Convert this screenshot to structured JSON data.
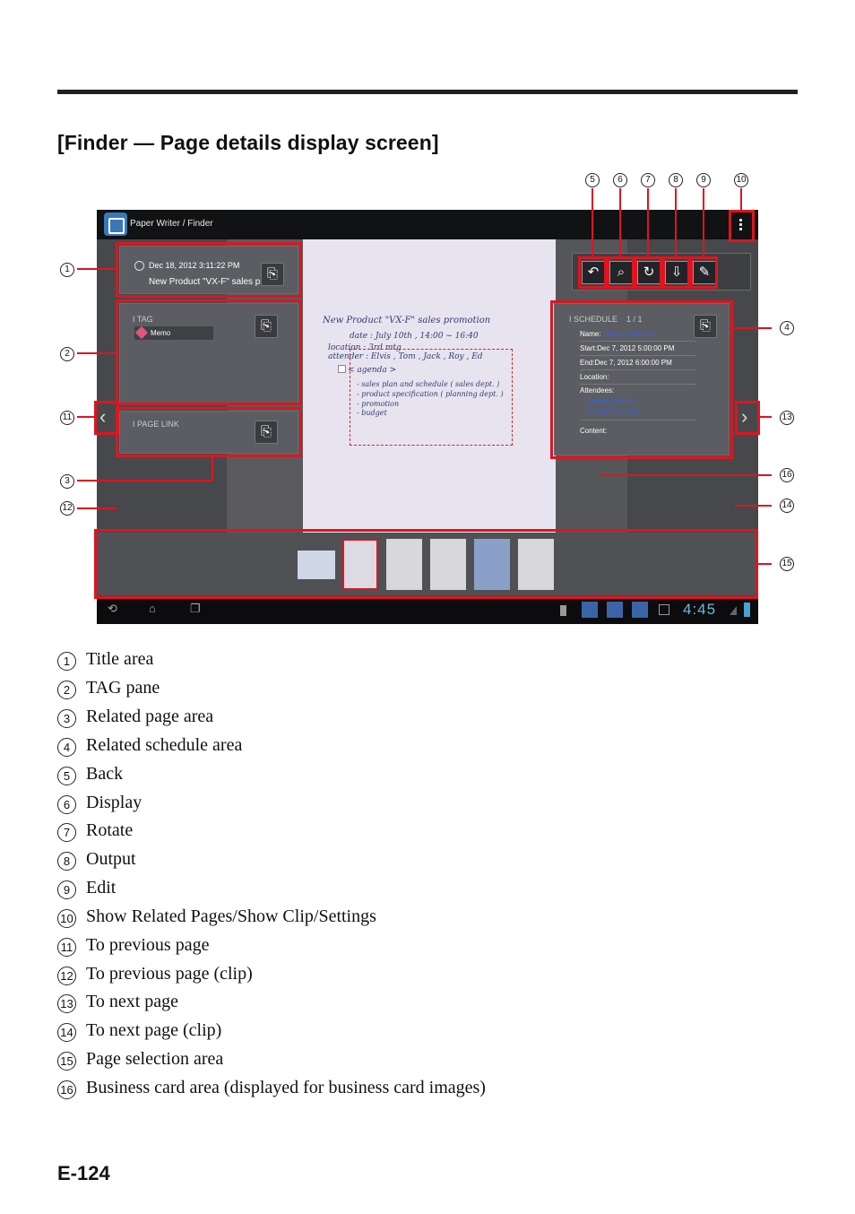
{
  "heading": "[Finder — Page details display screen]",
  "page_number": "E-124",
  "screen": {
    "app_title": "Paper Writer / Finder",
    "title_area": {
      "date": "Dec 18, 2012 3:11:22 PM",
      "name": "New Product \"VX-F\" sales pro..."
    },
    "tag_pane": {
      "header": "TAG",
      "tag": "Memo"
    },
    "page_link": {
      "header": "PAGE LINK"
    },
    "schedule": {
      "header": "SCHEDULE",
      "count": "1 / 1",
      "name_label": "Name:",
      "name_value": "Sales promotion",
      "start": "Start:Dec 7, 2012 5:00:00 PM",
      "end": "End:Dec 7, 2012 6:00:00 PM",
      "location": "Location:",
      "attendees_label": "Attendees:",
      "attendee_1": "Anthony Barton",
      "attendee_2": "Jackie Robinson",
      "content": "Content:"
    },
    "handwriting": {
      "line1": "New Product \"VX-F\" sales promotion",
      "line2": "date : July 10th , 14:00 ~ 16:40",
      "line3": "location : 3rd mtg",
      "line4": "attender : Elvis , Tom , Jack , Roy , Ed",
      "line5": "< agenda >",
      "line6": "- sales plan and schedule ( sales dept. )",
      "line7": "- product specification ( planning dept. )",
      "line8": "- promotion",
      "line9": "- budget"
    },
    "clock": "4:45"
  },
  "callouts": [
    "5",
    "6",
    "7",
    "8",
    "9",
    "10",
    "1",
    "2",
    "11",
    "3",
    "12",
    "4",
    "13",
    "16",
    "14",
    "15"
  ],
  "legend": [
    {
      "num": "1",
      "text": "Title area"
    },
    {
      "num": "2",
      "text": "TAG pane"
    },
    {
      "num": "3",
      "text": "Related page area"
    },
    {
      "num": "4",
      "text": "Related schedule area"
    },
    {
      "num": "5",
      "text": "Back"
    },
    {
      "num": "6",
      "text": "Display"
    },
    {
      "num": "7",
      "text": "Rotate"
    },
    {
      "num": "8",
      "text": "Output"
    },
    {
      "num": "9",
      "text": "Edit"
    },
    {
      "num": "10",
      "text": "Show Related Pages/Show Clip/Settings"
    },
    {
      "num": "11",
      "text": "To previous page"
    },
    {
      "num": "12",
      "text": "To previous page (clip)"
    },
    {
      "num": "13",
      "text": "To next page"
    },
    {
      "num": "14",
      "text": "To next page (clip)"
    },
    {
      "num": "15",
      "text": "Page selection area"
    },
    {
      "num": "16",
      "text": "Business card area (displayed for business card images)"
    }
  ],
  "colors": {
    "callout_red": "#e0141e",
    "screen_bg": "#47484c",
    "clock": "#6fb8dc",
    "link_blue": "#3a5fd8"
  }
}
